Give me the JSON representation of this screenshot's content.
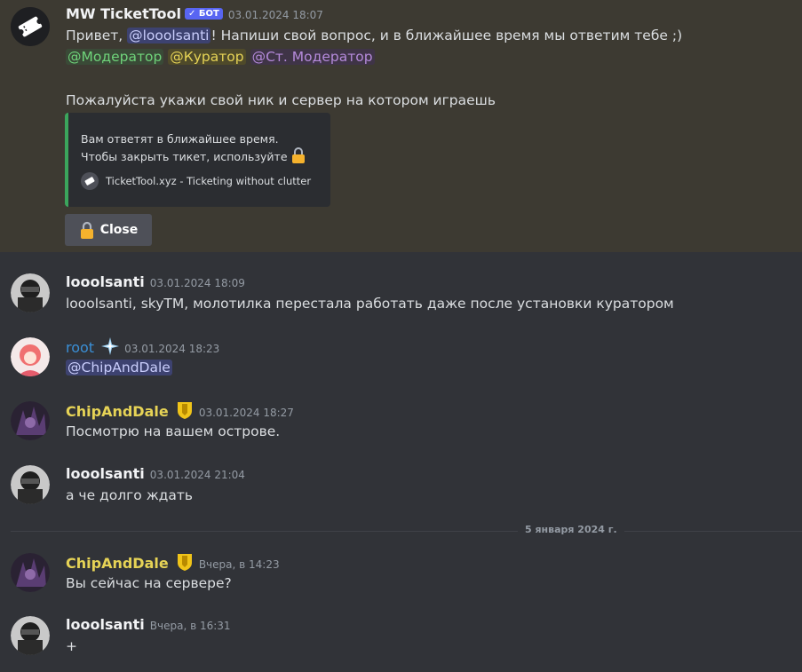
{
  "messages": [
    {
      "author": "MW TicketTool",
      "bot_tag": "✓ БОТ",
      "timestamp": "03.01.2024 18:07",
      "greeting_prefix": "Привет, ",
      "greeting_mention": "@looolsanti",
      "greeting_suffix": "! Напиши свой вопрос, и в ближайшее время мы ответим тебе ;)",
      "role_mentions": [
        "@Модератор",
        "@Куратор",
        "@Ст. Модератор"
      ],
      "instruction": "Пожалуйста укажи свой ник и сервер на котором играешь",
      "embed": {
        "line1": "Вам ответят в ближайшее время.",
        "line2": "Чтобы закрыть тикет, используйте",
        "footer": "TicketTool.xyz - Ticketing without clutter"
      },
      "button_label": "Close"
    },
    {
      "author": "looolsanti",
      "timestamp": "03.01.2024 18:09",
      "text": "looolsanti, skyTM, молотилка перестала работать даже после установки куратором"
    },
    {
      "author": "root",
      "timestamp": "03.01.2024 18:23",
      "text": "@ChipAndDale"
    },
    {
      "author": "ChipAndDale",
      "timestamp": "03.01.2024 18:27",
      "text": "Посмотрю на вашем острове."
    },
    {
      "author": "looolsanti",
      "timestamp": "03.01.2024 21:04",
      "text": "а че долго ждать"
    },
    {
      "author": "ChipAndDale",
      "timestamp": "Вчера, в 14:23",
      "text": "Вы сейчас на сервере?"
    },
    {
      "author": "looolsanti",
      "timestamp": "Вчера, в 16:31",
      "text": "+"
    }
  ],
  "date_divider": "5 января 2024 г.",
  "colors": {
    "background": "#313338",
    "highlight": "#3d3a32",
    "embed_border": "#3ba55c",
    "bot_tag": "#5865f2",
    "root_name": "#3a8fd6",
    "chipanddale_name": "#e6d356",
    "default_name": "#f2f3f5"
  },
  "icons": {
    "tickettool_avatar": "ticket-icon",
    "lock": "lock-icon",
    "badge": "shield-badge-icon",
    "root_badge": "sparkle-icon"
  }
}
